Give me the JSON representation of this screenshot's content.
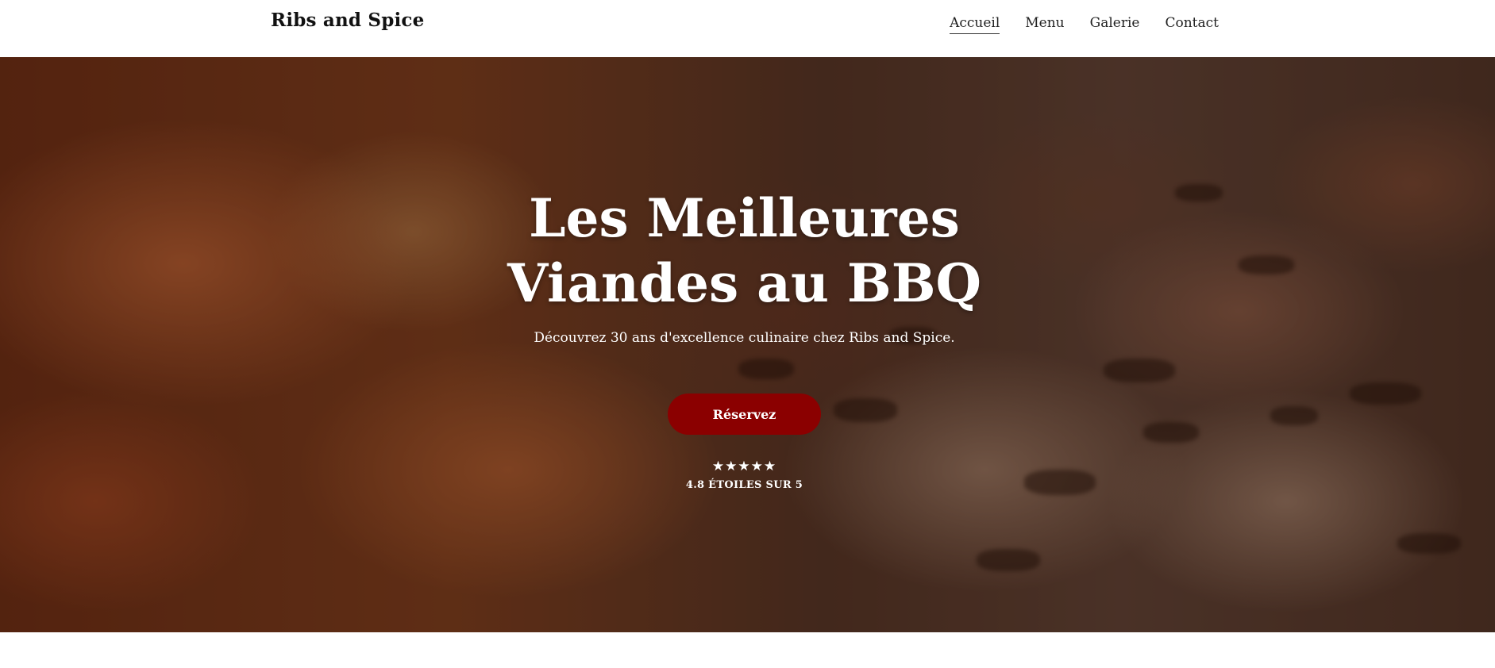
{
  "header": {
    "brand": "Ribs and Spice",
    "nav": [
      {
        "label": "Accueil",
        "active": true
      },
      {
        "label": "Menu",
        "active": false
      },
      {
        "label": "Galerie",
        "active": false
      },
      {
        "label": "Contact",
        "active": false
      }
    ]
  },
  "hero": {
    "title_line1": "Les Meilleures",
    "title_line2": "Viandes au BBQ",
    "subtitle": "Découvrez 30 ans d'excellence culinaire chez Ribs and Spice.",
    "cta_label": "Réservez",
    "rating_stars": "★★★★★",
    "rating_text": "4.8 ÉTOILES SUR 5",
    "rating_value": 4.8,
    "background_image": "grilled-meat-bbq-photo"
  },
  "colors": {
    "accent": "#8b0000",
    "text_dark": "#111111",
    "hero_text": "#ffffff"
  }
}
